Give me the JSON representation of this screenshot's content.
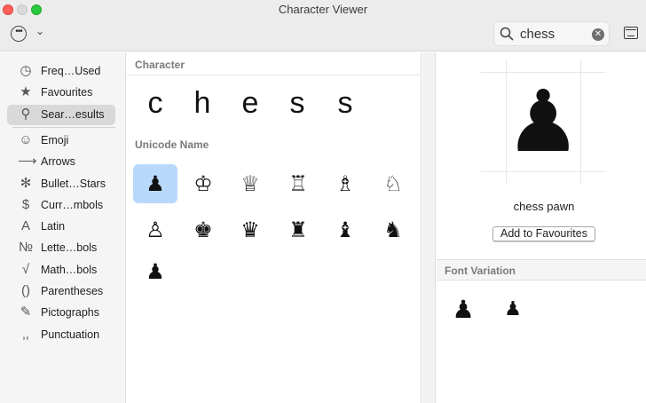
{
  "window": {
    "title": "Character Viewer"
  },
  "toolbar": {
    "action_icon": "ellipsis-circle-icon",
    "menu_icon": "chevron-down-icon",
    "search_value": "chess",
    "search_icon": "magnifier-icon",
    "clear_icon": "clear-icon",
    "keyboard_icon": "keyboard-viewer-icon"
  },
  "sidebar": {
    "items": [
      {
        "label": "Freq…Used",
        "glyph": "◷",
        "icon": "clock-icon"
      },
      {
        "label": "Favourites",
        "glyph": "★",
        "icon": "star-icon"
      },
      {
        "label": "Sear…esults",
        "glyph": "⚲",
        "icon": "search-icon",
        "selected": true
      },
      {
        "label": "Emoji",
        "glyph": "☺",
        "icon": "smiley-icon"
      },
      {
        "label": "Arrows",
        "glyph": "⟶",
        "icon": "arrow-icon"
      },
      {
        "label": "Bullet…Stars",
        "glyph": "✻",
        "icon": "asterisk-icon"
      },
      {
        "label": "Curr…mbols",
        "glyph": "$",
        "icon": "dollar-icon"
      },
      {
        "label": "Latin",
        "glyph": "A",
        "icon": "latin-a-icon"
      },
      {
        "label": "Lette…bols",
        "glyph": "№",
        "icon": "numero-icon"
      },
      {
        "label": "Math…bols",
        "glyph": "√",
        "icon": "square-root-icon"
      },
      {
        "label": "Parentheses",
        "glyph": "()",
        "icon": "parentheses-icon"
      },
      {
        "label": "Pictographs",
        "glyph": "✎",
        "icon": "pencil-icon"
      },
      {
        "label": "Punctuation",
        "glyph": "‚,",
        "icon": "punctuation-icon"
      }
    ]
  },
  "main": {
    "character_header": "Character",
    "search_chars": [
      "c",
      "h",
      "e",
      "s",
      "s"
    ],
    "unicode_header": "Unicode Name",
    "results": [
      {
        "glyph": "♟",
        "name": "chess pawn",
        "selected": true
      },
      {
        "glyph": "♔",
        "name": "white chess king"
      },
      {
        "glyph": "♕",
        "name": "white chess queen"
      },
      {
        "glyph": "♖",
        "name": "white chess rook"
      },
      {
        "glyph": "♗",
        "name": "white chess bishop"
      },
      {
        "glyph": "♘",
        "name": "white chess knight"
      },
      {
        "glyph": "♙",
        "name": "white chess pawn"
      },
      {
        "glyph": "♚",
        "name": "black chess king"
      },
      {
        "glyph": "♛",
        "name": "black chess queen"
      },
      {
        "glyph": "♜",
        "name": "black chess rook"
      },
      {
        "glyph": "♝",
        "name": "black chess bishop"
      },
      {
        "glyph": "♞",
        "name": "black chess knight"
      },
      {
        "glyph": "♟",
        "name": "black chess pawn"
      }
    ]
  },
  "detail": {
    "preview_glyph": "♟",
    "character_name": "chess pawn",
    "add_favourites_label": "Add to Favourites",
    "font_variation_header": "Font Variation",
    "variations": [
      "♟",
      "♟"
    ]
  },
  "colors": {
    "selection": "#b9d9fb",
    "sidebar_selected": "#d9d9d9"
  }
}
